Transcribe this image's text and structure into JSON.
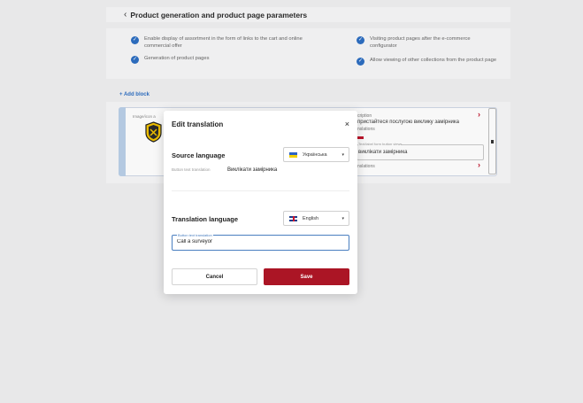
{
  "page": {
    "title": "Product generation and product page parameters",
    "options": [
      {
        "label": "Enable display of assortment in the form of links to the cart and online commercial offer"
      },
      {
        "label": "Generation of product pages"
      },
      {
        "label": "Visiting product pages after the e-commerce configurator"
      },
      {
        "label": "Allow viewing of other collections from the product page"
      }
    ],
    "add_block": "+ Add block",
    "card": {
      "image_label": "Image/icon a",
      "desc_label": "cription",
      "desc_value": "пристайтеся послугою виклику замірника",
      "translations_label": "nslations",
      "field_legend": "Text/label form button views",
      "field_value": "виклікати замірника",
      "translations_label2": "nslations"
    }
  },
  "modal": {
    "title": "Edit translation",
    "close": "×",
    "source_title": "Source language",
    "source_lang": "Українська",
    "source_caret": "▾",
    "source_field_label": "Button text translation",
    "source_field_value": "Виклікати замірника",
    "target_title": "Translation language",
    "target_lang": "English",
    "target_caret": "▾",
    "target_field_label": "Button text translation",
    "target_field_value": "Call a surveyor",
    "cancel": "Cancel",
    "save": "Save"
  }
}
